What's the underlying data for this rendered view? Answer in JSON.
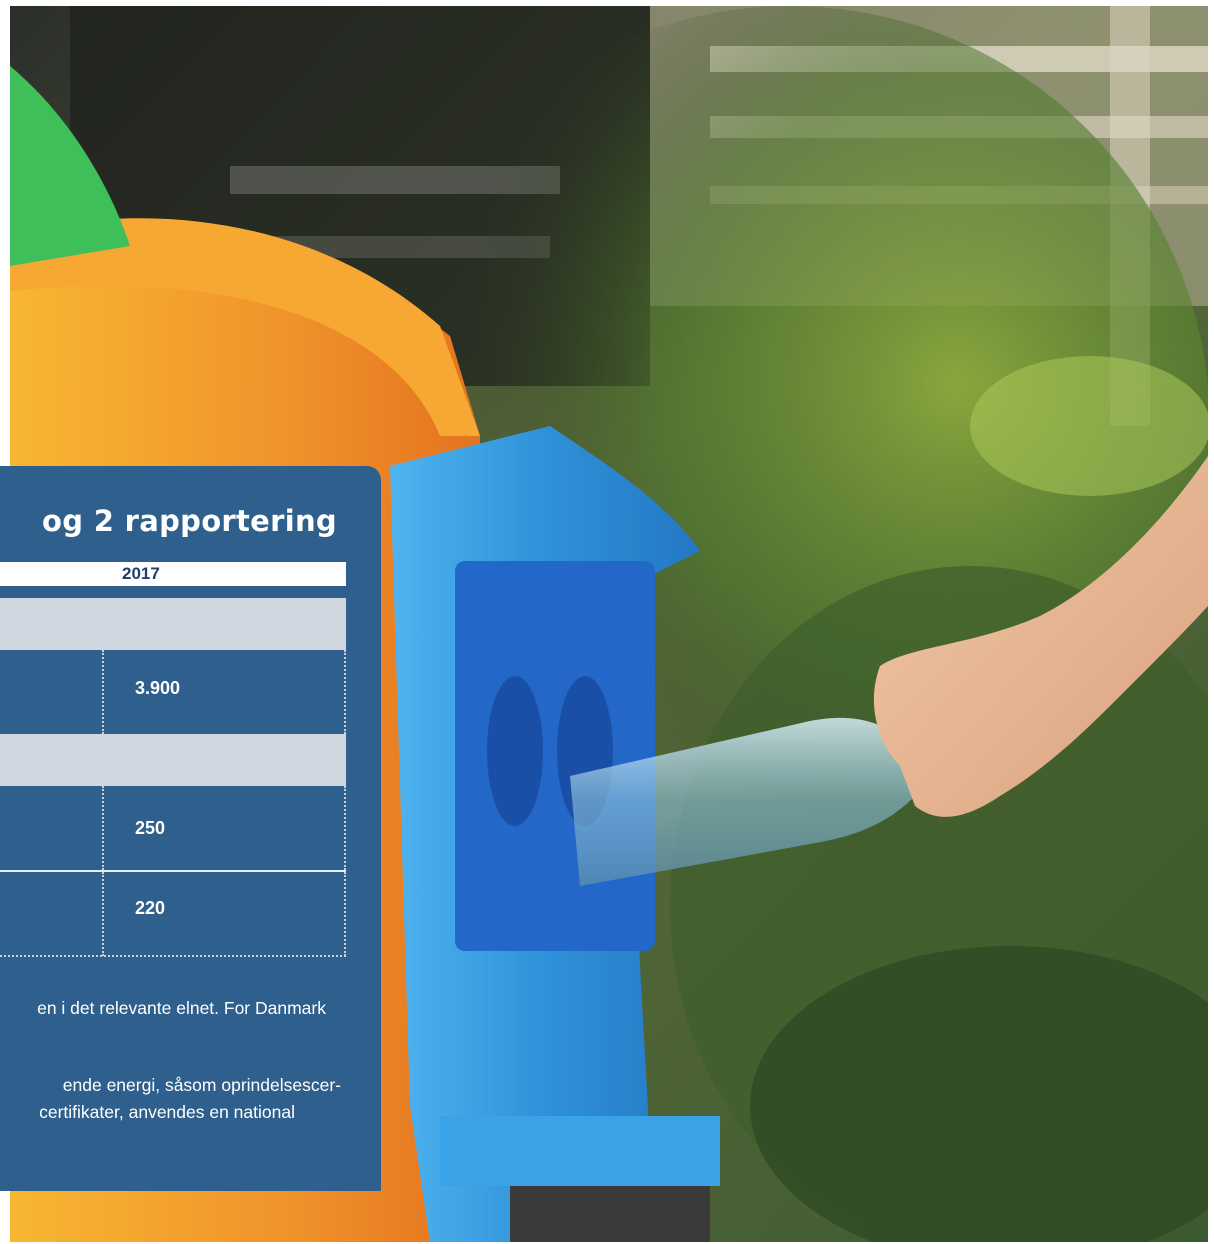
{
  "panel": {
    "title": "og 2 rapportering",
    "year_header": "2017",
    "values": [
      "3.900",
      "250",
      "220"
    ],
    "note_1": "en i det relevante elnet. For Danmark",
    "note_2_line_1": "ende energi, såsom oprindelsescer-",
    "note_2_line_2": "certifikater, anvendes en national"
  },
  "colors": {
    "panel": "#2f5f8c",
    "band": "#cfd6df",
    "bin_orange": "#f2922a",
    "bin_blue": "#2e90d8",
    "bin_lid_green": "#3fbf5a"
  }
}
